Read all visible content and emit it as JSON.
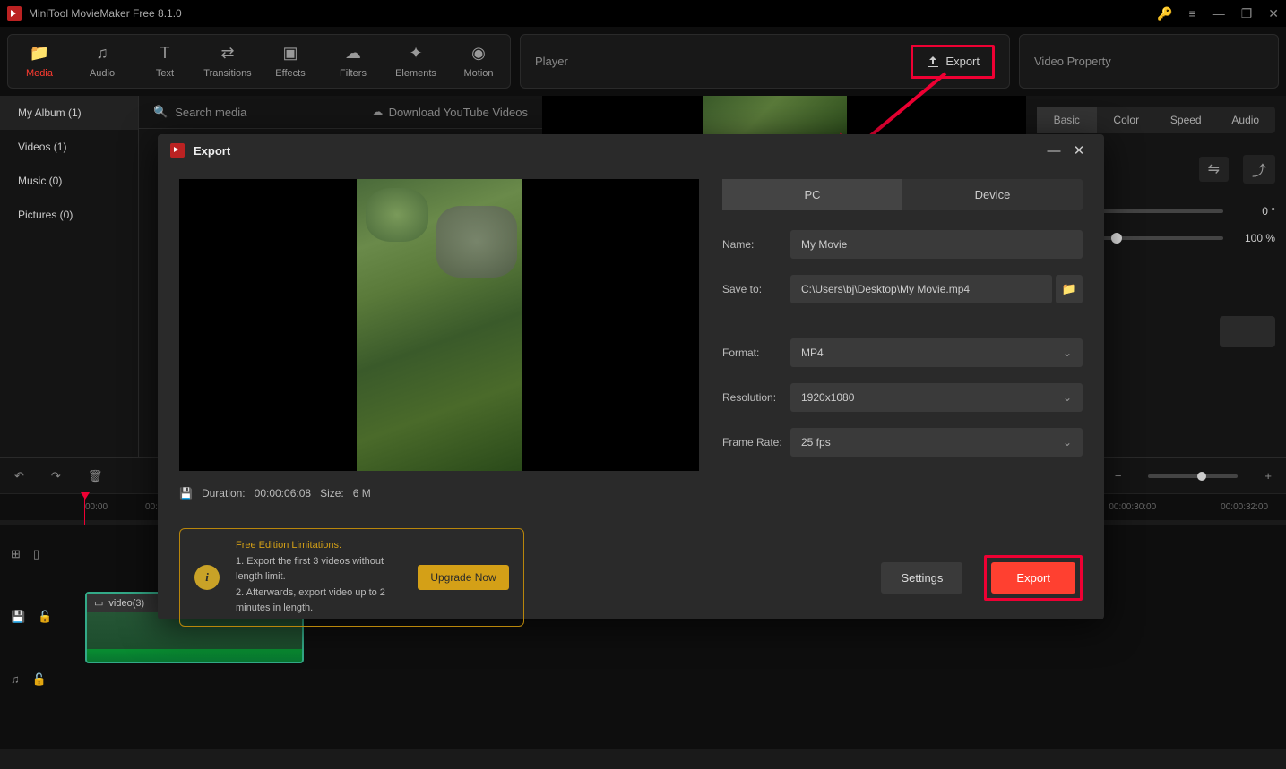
{
  "app": {
    "title": "MiniTool MovieMaker Free 8.1.0"
  },
  "toolbar": [
    {
      "label": "Media",
      "icon": "📁"
    },
    {
      "label": "Audio",
      "icon": "♫"
    },
    {
      "label": "Text",
      "icon": "T"
    },
    {
      "label": "Transitions",
      "icon": "⇄"
    },
    {
      "label": "Effects",
      "icon": "▣"
    },
    {
      "label": "Filters",
      "icon": "☁"
    },
    {
      "label": "Elements",
      "icon": "✦"
    },
    {
      "label": "Motion",
      "icon": "◉"
    }
  ],
  "player": {
    "label": "Player",
    "export_btn": "Export"
  },
  "prop_panel": {
    "title": "Video Property",
    "tabs": [
      "Basic",
      "Color",
      "Speed",
      "Audio"
    ],
    "rotation": "0 °",
    "scale": "100 %"
  },
  "sidebar": {
    "items": [
      "My Album (1)",
      "Videos (1)",
      "Music (0)",
      "Pictures (0)"
    ]
  },
  "search": {
    "placeholder": "Search media",
    "download": "Download YouTube Videos"
  },
  "timeline": {
    "marks": [
      "00:00",
      "00:0",
      "00:00:30:00",
      "00:00:32:00"
    ],
    "clip_label": "video(3)"
  },
  "dialog": {
    "title": "Export",
    "dest_tabs": [
      "PC",
      "Device"
    ],
    "fields": {
      "name_lbl": "Name:",
      "name_val": "My Movie",
      "save_lbl": "Save to:",
      "save_val": "C:\\Users\\bj\\Desktop\\My Movie.mp4",
      "format_lbl": "Format:",
      "format_val": "MP4",
      "res_lbl": "Resolution:",
      "res_val": "1920x1080",
      "fps_lbl": "Frame Rate:",
      "fps_val": "25 fps"
    },
    "info": {
      "duration_lbl": "Duration:",
      "duration_val": "00:00:06:08",
      "size_lbl": "Size:",
      "size_val": "6 M"
    },
    "limits": {
      "header": "Free Edition Limitations:",
      "line1": "1. Export the first 3 videos without length limit.",
      "line2": "2. Afterwards, export video up to 2 minutes in length.",
      "upgrade": "Upgrade Now"
    },
    "settings_btn": "Settings",
    "export_btn": "Export"
  }
}
